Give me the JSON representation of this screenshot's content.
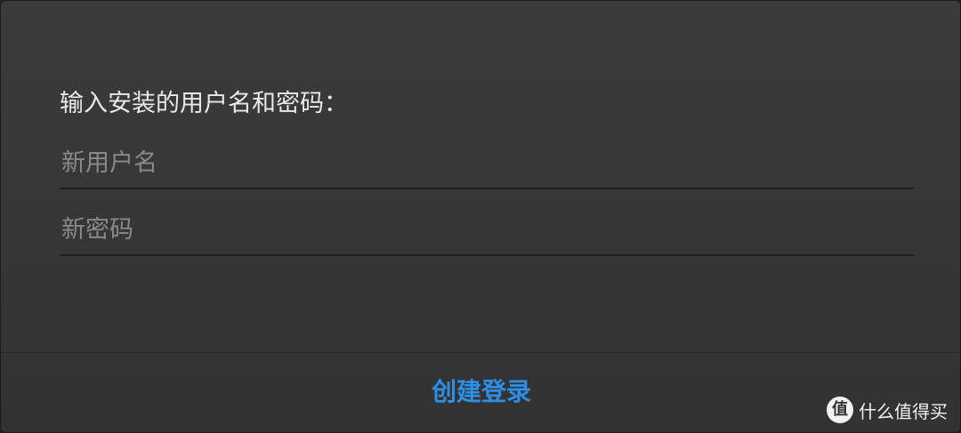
{
  "dialog": {
    "prompt": "输入安装的用户名和密码：",
    "username": {
      "value": "",
      "placeholder": "新用户名"
    },
    "password": {
      "value": "",
      "placeholder": "新密码"
    },
    "create_label": "创建登录",
    "accent_color": "#2d8ee8"
  },
  "watermark": {
    "logo_glyph": "值",
    "text": "什么值得买"
  }
}
